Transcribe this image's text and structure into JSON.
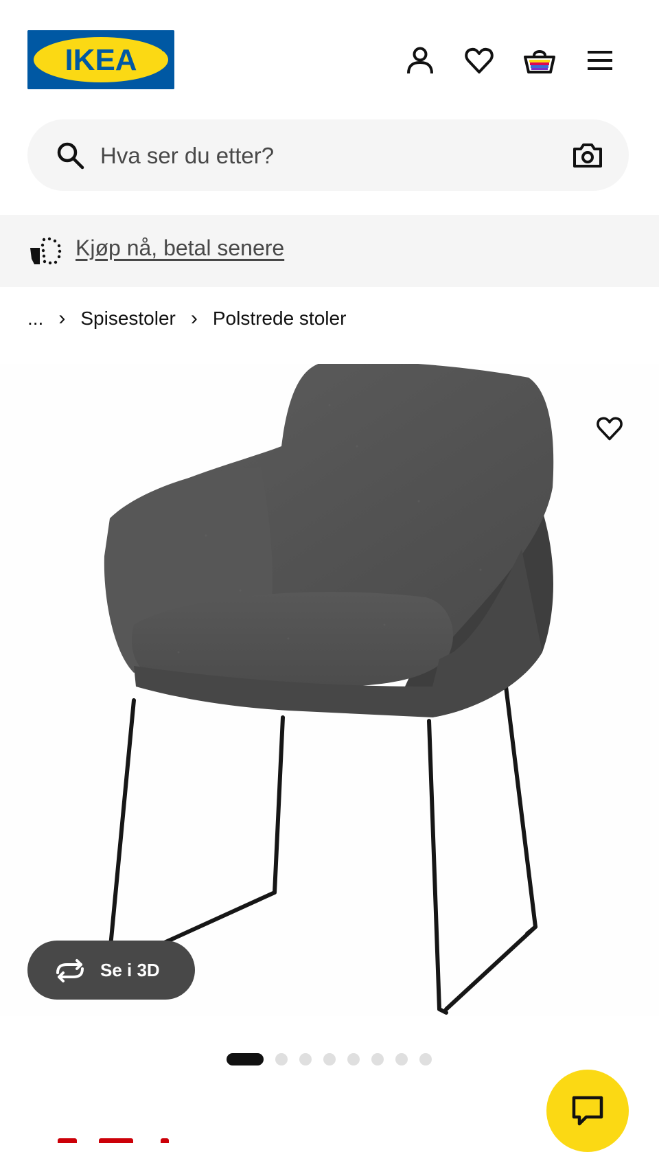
{
  "header": {
    "logo_text": "IKEA",
    "icons": [
      "profile-icon",
      "favourites-icon",
      "cart-icon",
      "menu-icon"
    ]
  },
  "search": {
    "placeholder": "Hva ser du etter?",
    "value": ""
  },
  "promo": {
    "link_text": "Kjøp nå, betal senere"
  },
  "breadcrumb": {
    "items": [
      "...",
      "Spisestoler",
      "Polstrede stoler"
    ]
  },
  "gallery": {
    "view_3d_label": "Se i 3D",
    "slide_count": 8,
    "active_slide": 1
  },
  "colors": {
    "brand_blue": "#0058a3",
    "brand_yellow": "#fbd914",
    "dark_button": "#484848",
    "search_bg": "#f5f5f5",
    "sale_red": "#cc0008"
  }
}
